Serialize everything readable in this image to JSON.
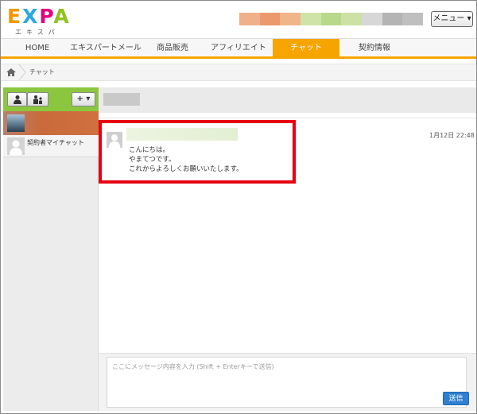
{
  "logo": {
    "letters": [
      "E",
      "X",
      "P",
      "A"
    ],
    "subtitle": "エキスパ",
    "colors": [
      "#f39800",
      "#29a9e0",
      "#e4007f",
      "#8fc31f"
    ]
  },
  "header": {
    "menu_label": "メニュー ▾",
    "blurred_colors": [
      "#f0b08a",
      "#ea9a6e",
      "#f0b589",
      "#cfe3a8",
      "#b9d98a",
      "#cde1a4",
      "#d7d7d7",
      "#b4b4b4",
      "#bfbfbf"
    ]
  },
  "nav": {
    "items": [
      {
        "label": "HOME",
        "active": false
      },
      {
        "label": "エキスパートメール",
        "active": false
      },
      {
        "label": "商品販売",
        "active": false
      },
      {
        "label": "アフィリエイト",
        "active": false
      },
      {
        "label": "チャット",
        "active": true
      },
      {
        "label": "契約情報",
        "active": false
      }
    ],
    "accent_color": "#f5a400"
  },
  "breadcrumb": {
    "current": "チャット"
  },
  "sidebar": {
    "accent_color": "#8cc63f",
    "buttons": [
      "user-icon",
      "group-icon",
      "+ ▾"
    ],
    "chats": [
      {
        "label": ""
      },
      {
        "label": "契約者マイチャット"
      }
    ]
  },
  "message": {
    "time": "1月12日 22:48",
    "lines": [
      "こんにちは。",
      "やまてつです。",
      "これからよろしくお願いいたします。"
    ]
  },
  "composer": {
    "placeholder": "ここにメッセージ内容を入力 (Shift + Enterキーで送信)",
    "send_label": "送信",
    "send_color": "#2f7fd1"
  }
}
